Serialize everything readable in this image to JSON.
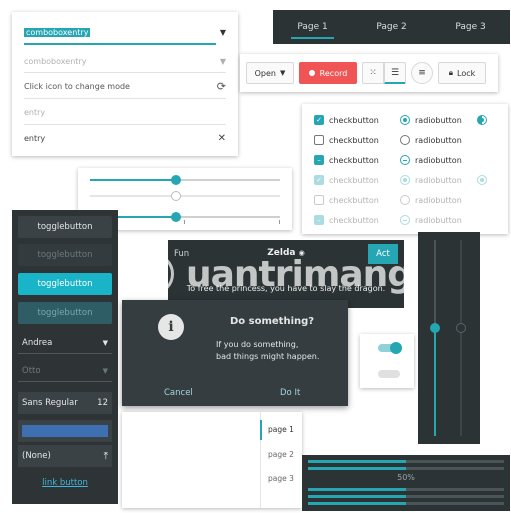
{
  "colors": {
    "accent": "#26a5b3",
    "record": "#f05454",
    "dark_bg": "#2e3436"
  },
  "entries": {
    "comboboxentry_value": "comboboxentry",
    "comboboxentry_disabled": "comboboxentry",
    "icon_mode_text": "Click icon to change mode",
    "entry_placeholder": "entry",
    "entry_value": "entry"
  },
  "tabs": {
    "items": [
      "Page 1",
      "Page 2",
      "Page 3"
    ],
    "active": 0
  },
  "toolbar": {
    "open_label": "Open",
    "record_label": "Record",
    "lock_label": "Lock"
  },
  "checks": {
    "checkbutton": "checkbutton",
    "radiobutton": "radiobutton"
  },
  "sliders": {
    "values": [
      0.45,
      0.45,
      0.45
    ]
  },
  "sidebar": {
    "toggle1": "togglebutton",
    "toggle2": "togglebutton",
    "toggle3": "togglebutton",
    "toggle4": "togglebutton",
    "combo1": "Andrea",
    "combo2": "Otto",
    "font_name": "Sans Regular",
    "font_size": "12",
    "file_value": "(None)",
    "link": "link button"
  },
  "headerbar": {
    "title": "Zelda",
    "left_text": "Fun",
    "act_label": "Act",
    "subtitle": "To free the princess, you have to slay the dragon."
  },
  "dialog": {
    "icon": "info-icon",
    "title": "Do something?",
    "body_line1": "If you do something,",
    "body_line2": "bad things might happen.",
    "cancel": "Cancel",
    "ok": "Do It"
  },
  "pages": {
    "items": [
      "page 1",
      "page 2",
      "page 3"
    ],
    "active": 0
  },
  "progress": {
    "label": "50%",
    "value": 0.5
  },
  "watermark": {
    "text": "uantrimang"
  }
}
